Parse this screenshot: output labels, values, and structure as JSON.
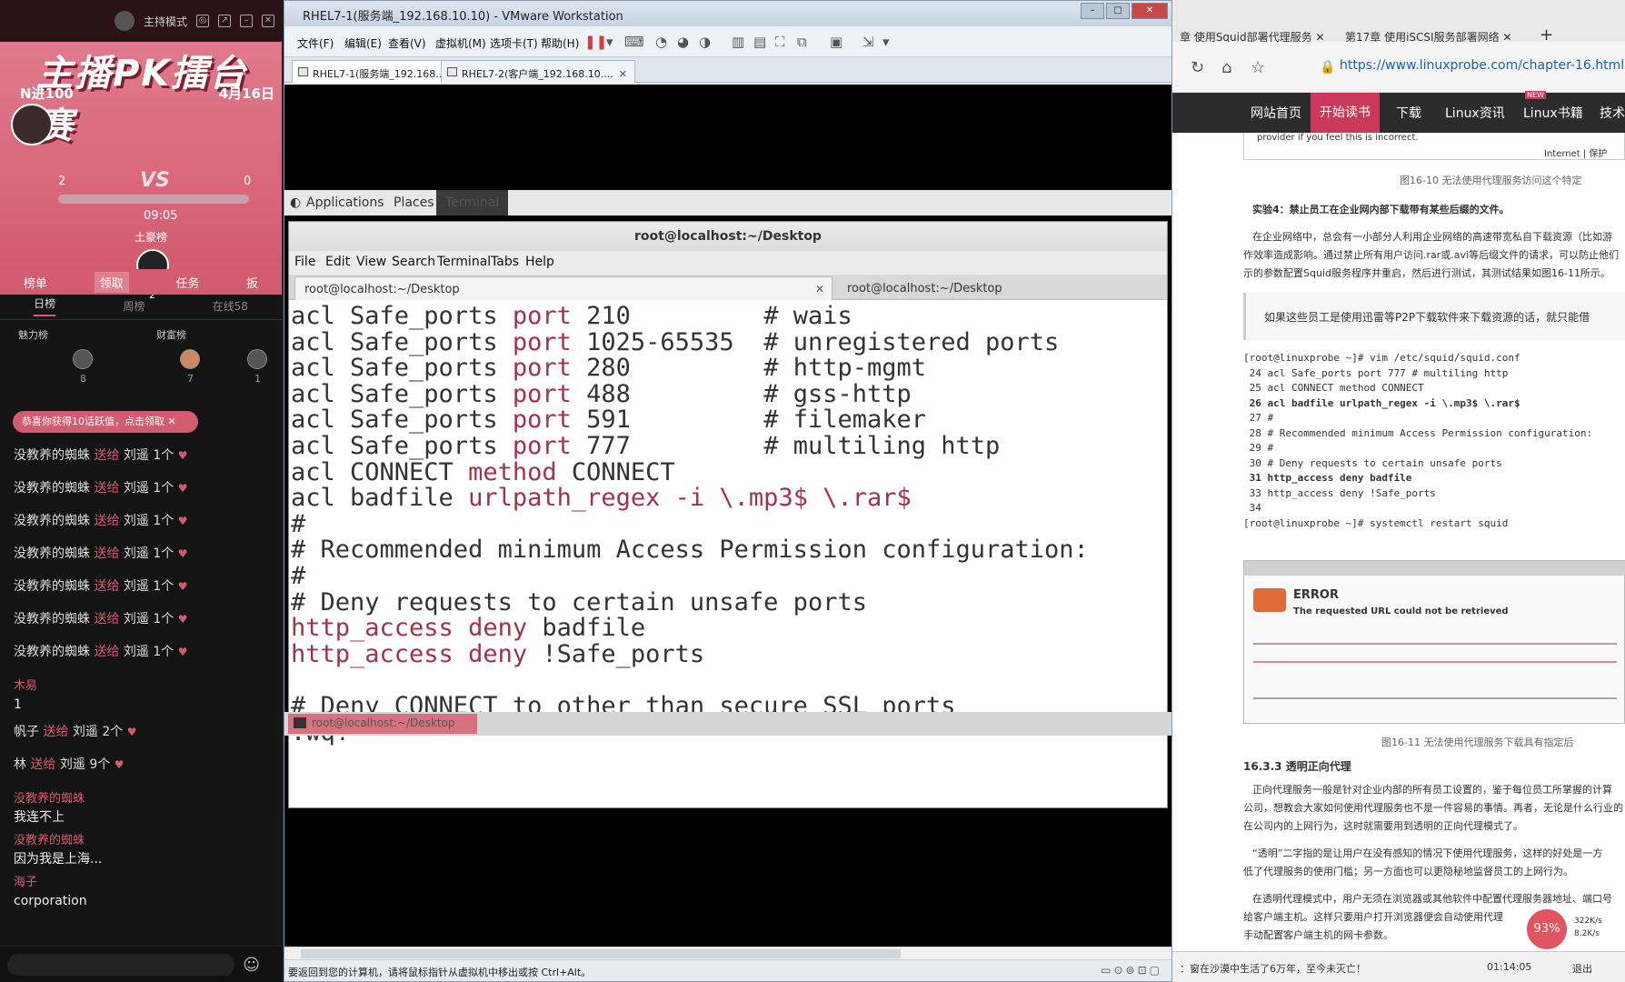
{
  "live": {
    "mode_label": "主持模式",
    "event_title": "主播PK擂台赛",
    "round": "N进100",
    "date": "4月16日",
    "vs": "VS",
    "score_left": "2",
    "score_right": "0",
    "timer": "09:05",
    "rank_title": "土豪榜",
    "top_count": "2",
    "menu": [
      "榜单",
      "领取",
      "任务",
      "扳"
    ],
    "tabs": [
      "日榜",
      "周榜",
      "在线58"
    ],
    "charm_label": "魅力榜",
    "wealth_label": "财富榜",
    "rank_counts": [
      "8",
      "7",
      "1"
    ],
    "notice": "恭喜你获得10话跃值，点击领取",
    "chat_gifts": [
      {
        "user": "没教养的蜘蛛",
        "verb": "送给",
        "target": "刘遥",
        "count": "1个"
      },
      {
        "user": "没教养的蜘蛛",
        "verb": "送给",
        "target": "刘遥",
        "count": "1个"
      },
      {
        "user": "没教养的蜘蛛",
        "verb": "送给",
        "target": "刘遥",
        "count": "1个"
      },
      {
        "user": "没教养的蜘蛛",
        "verb": "送给",
        "target": "刘遥",
        "count": "1个"
      },
      {
        "user": "没教养的蜘蛛",
        "verb": "送给",
        "target": "刘遥",
        "count": "1个"
      },
      {
        "user": "没教养的蜘蛛",
        "verb": "送给",
        "target": "刘遥",
        "count": "1个"
      },
      {
        "user": "没教养的蜘蛛",
        "verb": "送给",
        "target": "刘遥",
        "count": "1个"
      }
    ],
    "chat_msgs": [
      {
        "name": "木易",
        "text": "1"
      }
    ],
    "gift2": {
      "user": "帆子",
      "verb": "送给",
      "target": "刘遥",
      "count": "2个"
    },
    "gift3": {
      "user": "林",
      "verb": "送给",
      "target": "刘遥",
      "count": "9个"
    },
    "chat_msgs2": [
      {
        "name": "没教养的蜘蛛",
        "text": "我连不上"
      },
      {
        "name": "没教养的蜘蛛",
        "text": "因为我是上海..."
      },
      {
        "name": "海子",
        "text": "corporation"
      }
    ]
  },
  "vmware": {
    "title": "RHEL7-1(服务端_192.168.10.10) - VMware Workstation",
    "menu": [
      "文件(F)",
      "编辑(E)",
      "查看(V)",
      "虚拟机(M)",
      "选项卡(T)",
      "帮助(H)"
    ],
    "tabs": [
      "RHEL7-1(服务端_192.168....",
      "RHEL7-2(客户端_192.168.10...."
    ],
    "status_msg": "要返回到您的计算机，请将鼠标指针从虚拟机中移出或按 Ctrl+Alt。"
  },
  "gnome": {
    "applications": "Applications",
    "places": "Places",
    "terminal": "Terminal",
    "taskbar_item": "root@localhost:~/Desktop"
  },
  "terminal": {
    "title": "root@localhost:~/Desktop",
    "menu": [
      "File",
      "Edit",
      "View",
      "Search",
      "Terminal",
      "Tabs",
      "Help"
    ],
    "tab_active": "root@localhost:~/Desktop",
    "tab_inactive": "root@localhost:~/Desktop",
    "lines": [
      [
        {
          "t": "acl Safe_ports ",
          "c": "n"
        },
        {
          "t": "port",
          "c": "k"
        },
        {
          "t": " 210         # wais",
          "c": "n"
        }
      ],
      [
        {
          "t": "acl Safe_ports ",
          "c": "n"
        },
        {
          "t": "port",
          "c": "k"
        },
        {
          "t": " 1025-65535  # unregistered ports",
          "c": "n"
        }
      ],
      [
        {
          "t": "acl Safe_ports ",
          "c": "n"
        },
        {
          "t": "port",
          "c": "k"
        },
        {
          "t": " 280         # http-mgmt",
          "c": "n"
        }
      ],
      [
        {
          "t": "acl Safe_ports ",
          "c": "n"
        },
        {
          "t": "port",
          "c": "k"
        },
        {
          "t": " 488         # gss-http",
          "c": "n"
        }
      ],
      [
        {
          "t": "acl Safe_ports ",
          "c": "n"
        },
        {
          "t": "port",
          "c": "k"
        },
        {
          "t": " 591         # filemaker",
          "c": "n"
        }
      ],
      [
        {
          "t": "acl Safe_ports ",
          "c": "n"
        },
        {
          "t": "port",
          "c": "k"
        },
        {
          "t": " 777         # multiling http",
          "c": "n"
        }
      ],
      [
        {
          "t": "acl CONNECT ",
          "c": "n"
        },
        {
          "t": "method",
          "c": "k"
        },
        {
          "t": " CONNECT",
          "c": "n"
        }
      ],
      [
        {
          "t": "acl badfile ",
          "c": "n"
        },
        {
          "t": "urlpath_regex -i \\.mp3$ \\.rar$",
          "c": "k"
        }
      ],
      [
        {
          "t": "#",
          "c": "n"
        }
      ],
      [
        {
          "t": "# Recommended minimum Access Permission configuration:",
          "c": "n"
        }
      ],
      [
        {
          "t": "#",
          "c": "n"
        }
      ],
      [
        {
          "t": "# Deny requests to certain unsafe ports",
          "c": "n"
        }
      ],
      [
        {
          "t": "http_access deny",
          "c": "k"
        },
        {
          "t": " badfile",
          "c": "n"
        }
      ],
      [
        {
          "t": "http_access deny",
          "c": "k"
        },
        {
          "t": " !Safe_ports",
          "c": "n"
        }
      ],
      [
        {
          "t": "",
          "c": "n"
        }
      ],
      [
        {
          "t": "# Deny CONNECT to other than secure SSL ports",
          "c": "n"
        }
      ],
      [
        {
          "t": ":wq!",
          "c": "n"
        }
      ]
    ]
  },
  "browser": {
    "tab1": "章 使用Squid部署代理服务",
    "tab2": "第17章 使用iSCSI服务部署网络",
    "url": "https://www.linuxprobe.com/chapter-16.html#163",
    "nav": [
      "网站首页",
      "开始读书",
      "下载",
      "Linux资讯",
      "Linux书籍",
      "技术"
    ],
    "nav_badge": "NEW",
    "provider_text": "provider if you feel this is incorrect.",
    "internet_label": "Internet | 保护",
    "fig10": "图16-10  无法使用代理服务访问这个特定",
    "exp4": "实验4：禁止员工在企业网内部下载带有某些后缀的文件。",
    "para1a": "在企业网络中，总会有一小部分人利用企业网络的高速带宽私自下载资源（比如游",
    "para1b": "作效率造成影响。通过禁止所有用户访问.rar或.avi等后缀文件的请求，可以防止他们",
    "para1c": "示的参数配置Squid服务程序并重启，然后进行测试，其测试结果如图16-11所示。",
    "tip": "如果这些员工是使用迅雷等P2P下载软件来下载资源的话，就只能借",
    "code": [
      {
        "t": "[root@linuxprobe ~]# vim /etc/squid/squid.conf",
        "b": false
      },
      {
        "t": " 24 acl Safe_ports port 777 # multiling http",
        "b": false
      },
      {
        "t": " 25 acl CONNECT method CONNECT",
        "b": false
      },
      {
        "t": " 26 acl badfile urlpath_regex -i \\.mp3$ \\.rar$",
        "b": true
      },
      {
        "t": " 27 #",
        "b": false
      },
      {
        "t": " 28 # Recommended minimum Access Permission configuration:",
        "b": false
      },
      {
        "t": " 29 #",
        "b": false
      },
      {
        "t": " 30 # Deny requests to certain unsafe ports",
        "b": false
      },
      {
        "t": " 31 http_access deny badfile",
        "b": true
      },
      {
        "t": " 33 http_access deny !Safe_ports",
        "b": false
      },
      {
        "t": " 34",
        "b": false
      },
      {
        "t": "[root@linuxprobe ~]# systemctl restart squid",
        "b": false
      }
    ],
    "error_title": "ERROR",
    "error_sub": "The requested URL could not be retrieved",
    "fig11": "图16-11  无法使用代理服务下载具有指定后",
    "sec": "16.3.3 透明正向代理",
    "para2a": "正向代理服务一般是针对企业内部的所有员工设置的，鉴于每位员工所掌握的计算",
    "para2b": "公司，想教会大家如何使用代理服务也不是一件容易的事情。再者，无论是什么行业的",
    "para2c": "在公司内的上网行为，这时就需要用到透明的正向代理模式了。",
    "para3a": "“透明”二字指的是让用户在没有感知的情况下使用代理服务，这样的好处是一方",
    "para3b": "低了代理服务的使用门槛；另一方面也可以更隐秘地监督员工的上网行为。",
    "para4a": "在透明代理模式中，用户无须在浏览器或其他软件中配置代理服务器地址、端口号",
    "para4b": "给客户端主机。这样只要用户打开浏览器便会自动使用代理",
    "para4c": "手动配置客户端主机的网卡参数。",
    "percent": "93%",
    "speed_up": "322K/s",
    "speed_down": "8.2K/s",
    "status_text": "：窗在沙漠中生活了6万年，至今未灭亡！",
    "time": "01:14:05",
    "back": "退出"
  }
}
